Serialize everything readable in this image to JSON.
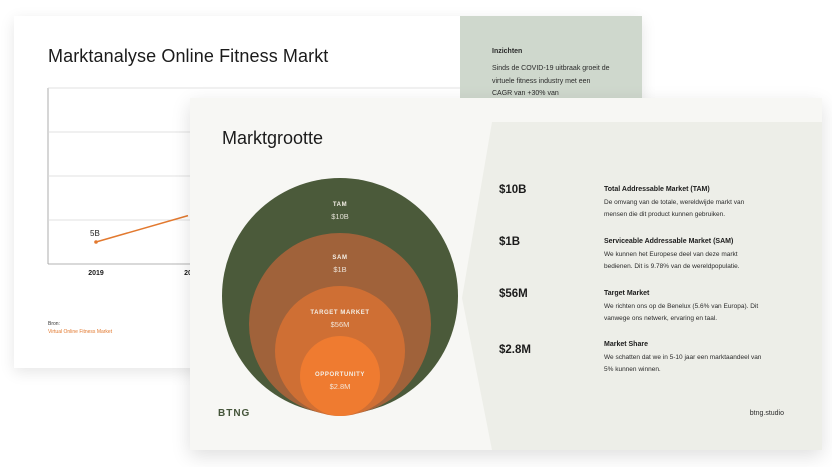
{
  "back_slide": {
    "title": "Marktanalyse Online Fitness Markt",
    "insights": {
      "title": "Inzichten",
      "text": "Sinds de COVID-19 uitbraak groeit de virtuele fitness industry met een CAGR van +30% van"
    },
    "source": {
      "label": "Bron:",
      "value": "Virtual Online Fitness Market"
    }
  },
  "chart_data": {
    "type": "line",
    "x": [
      "2019",
      "20"
    ],
    "series": [
      {
        "values": [
          5,
          11
        ]
      }
    ],
    "data_labels": [
      "5B"
    ],
    "grid": true,
    "colors": {
      "line": "#e2792f",
      "grid": "#d9d9d9"
    }
  },
  "front_slide": {
    "title": "Marktgrootte",
    "circles": [
      {
        "name": "TAM",
        "value": "$10B",
        "color": "#4b5a3a"
      },
      {
        "name": "SAM",
        "value": "$1B",
        "color": "#a0623a"
      },
      {
        "name": "TARGET MARKET",
        "value": "$56M",
        "color": "#cf6f34"
      },
      {
        "name": "OPPORTUNITY",
        "value": "$2.8M",
        "color": "#ef7b30"
      }
    ],
    "metrics": [
      {
        "value": "$10B",
        "title": "Total Addressable Market (TAM)",
        "desc": "De omvang van de totale, wereldwijde markt van mensen die dit product kunnen gebruiken."
      },
      {
        "value": "$1B",
        "title": "Serviceable Addressable Market (SAM)",
        "desc": "We kunnen het Europese deel van deze markt bedienen. Dit is 9.78% van de wereldpopulatie."
      },
      {
        "value": "$56M",
        "title": "Target Market",
        "desc": "We richten ons op de Benelux (5.6% van Europa). Dit vanwege ons netwerk, ervaring en taal."
      },
      {
        "value": "$2.8M",
        "title": "Market Share",
        "desc": "We schatten dat we in 5-10 jaar een marktaandeel van 5% kunnen winnen."
      }
    ],
    "logo": "BTNG",
    "website": "btng.studio"
  }
}
